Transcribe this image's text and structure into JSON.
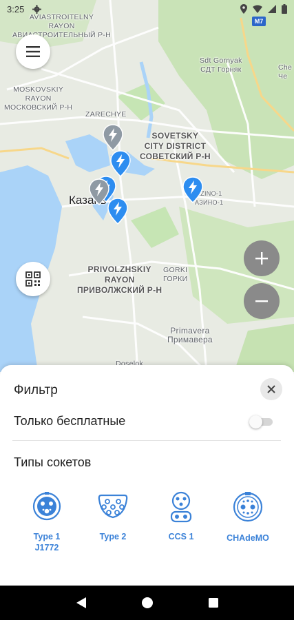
{
  "status_bar": {
    "time": "3:25",
    "icons": [
      "settings-icon",
      "location-icon",
      "wifi-icon",
      "signal-icon",
      "battery-icon"
    ]
  },
  "map": {
    "road_badge": "M7",
    "labels": {
      "aviastroitelny": "AVIASTROITELNY\nRAYON\nАВИАСТРОИТЕЛЬНЫЙ Р-Н",
      "moskovsky": "MOSKOVSKIY\nRAYON\nМОСКОВСКИЙ Р-Н",
      "zarechye": "ZARECHYE",
      "sovetsky": "SOVETSKY\nCITY DISTRICT\nСОВЕТСКИЙ Р-Н",
      "gornyak": "Sdt Gornyak\nСДТ Горняк",
      "kazan": "Казань",
      "kazino": "AZINO-1\nАЗИНО-1",
      "privolzhsky": "PRIVOLZHSKIY\nRAYON\nПРИВОЛЖСКИЙ Р-Н",
      "gorki": "GORKI\nГОРКИ",
      "primavera": "Primavera\nПримавера",
      "che": "Che\nЧе",
      "doselok": "Doselok"
    },
    "colors": {
      "water": "#aadaff",
      "land": "#e8ebe3",
      "park": "#c6e5b4",
      "road": "#ffffff",
      "pin_active": "#2d8df0",
      "pin_inactive": "#8f9aa4"
    }
  },
  "filter": {
    "title": "Фильтр",
    "free_only_label": "Только бесплатные",
    "free_only_enabled": false,
    "socket_types_label": "Типы сокетов",
    "sockets": [
      {
        "label": "Type 1\nJ1772",
        "icon": "type1-socket-icon"
      },
      {
        "label": "Type 2",
        "icon": "type2-socket-icon"
      },
      {
        "label": "CCS 1",
        "icon": "ccs1-socket-icon"
      },
      {
        "label": "CHAdeMO",
        "icon": "chademo-socket-icon"
      }
    ],
    "accent_color": "#3b82d8"
  },
  "nav_bar": {
    "buttons": [
      "back-icon",
      "home-icon",
      "recents-icon"
    ]
  }
}
